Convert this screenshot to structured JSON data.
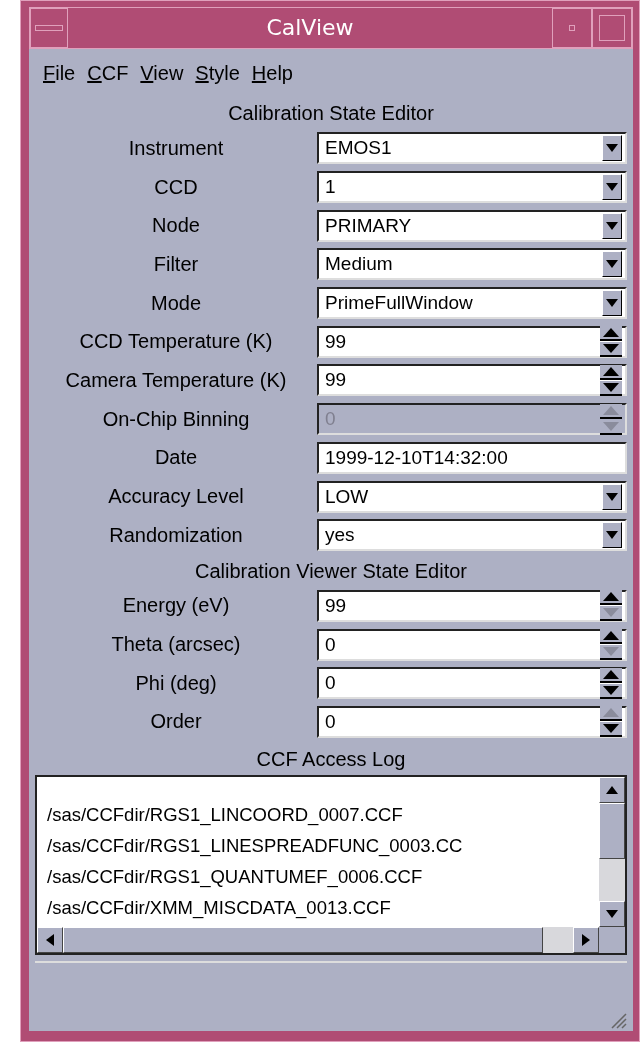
{
  "window": {
    "title": "CalView"
  },
  "menu": [
    "File",
    "CCF",
    "View",
    "Style",
    "Help"
  ],
  "sections": [
    {
      "title": "Calibration State Editor",
      "rows": [
        {
          "label": "Instrument",
          "kind": "dropdown",
          "value": "EMOS1",
          "disabled": false
        },
        {
          "label": "CCD",
          "kind": "dropdown",
          "value": "1",
          "disabled": false
        },
        {
          "label": "Node",
          "kind": "dropdown",
          "value": "PRIMARY",
          "disabled": false
        },
        {
          "label": "Filter",
          "kind": "dropdown",
          "value": "Medium",
          "disabled": false
        },
        {
          "label": "Mode",
          "kind": "dropdown",
          "value": "PrimeFullWindow",
          "disabled": false
        },
        {
          "label": "CCD Temperature (K)",
          "kind": "spinner",
          "value": "99",
          "disabled": false,
          "up_disabled": false,
          "down_disabled": false
        },
        {
          "label": "Camera Temperature (K)",
          "kind": "spinner",
          "value": "99",
          "disabled": false,
          "up_disabled": false,
          "down_disabled": false
        },
        {
          "label": "On-Chip Binning",
          "kind": "spinner",
          "value": "0",
          "disabled": true,
          "up_disabled": true,
          "down_disabled": true
        },
        {
          "label": "Date",
          "kind": "text",
          "value": "1999-12-10T14:32:00",
          "disabled": false
        },
        {
          "label": "Accuracy Level",
          "kind": "dropdown",
          "value": "LOW",
          "disabled": false
        },
        {
          "label": "Randomization",
          "kind": "dropdown",
          "value": "yes",
          "disabled": false
        }
      ]
    },
    {
      "title": "Calibration Viewer State Editor",
      "rows": [
        {
          "label": "Energy (eV)",
          "kind": "spinner",
          "value": "99",
          "disabled": false,
          "up_disabled": false,
          "down_disabled": true
        },
        {
          "label": "Theta (arcsec)",
          "kind": "spinner",
          "value": "0",
          "disabled": false,
          "up_disabled": false,
          "down_disabled": true
        },
        {
          "label": "Phi (deg)",
          "kind": "spinner",
          "value": "0",
          "disabled": false,
          "up_disabled": false,
          "down_disabled": false
        },
        {
          "label": "Order",
          "kind": "spinner",
          "value": "0",
          "disabled": false,
          "up_disabled": true,
          "down_disabled": false
        }
      ]
    }
  ],
  "log": {
    "title": "CCF Access Log",
    "lines": [
      "/sas/CCFdir/RGS1_LINCOORD_0007.CCF",
      "/sas/CCFdir/RGS1_LINESPREADFUNC_0003.CC",
      "/sas/CCFdir/RGS1_QUANTUMEF_0006.CCF",
      "/sas/CCFdir/XMM_MISCDATA_0013.CCF"
    ]
  }
}
